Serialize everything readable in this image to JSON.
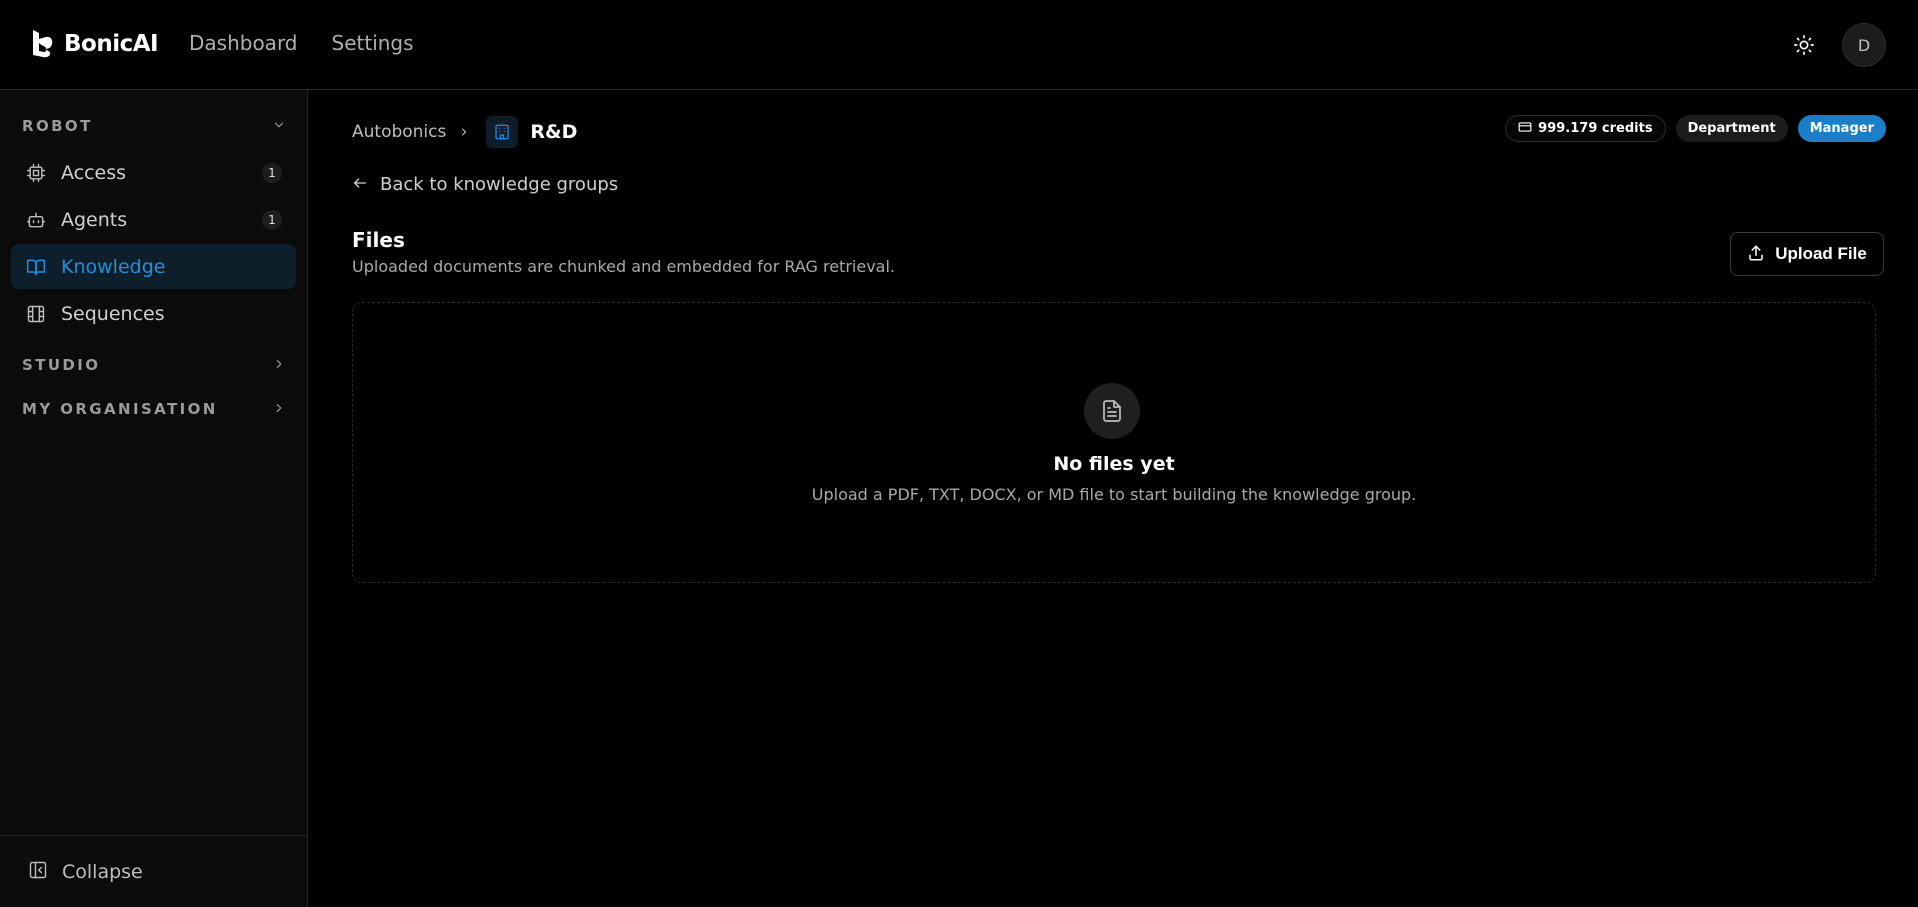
{
  "header": {
    "brand": "BonicAI",
    "nav": [
      "Dashboard",
      "Settings"
    ],
    "avatar_initial": "D"
  },
  "sidebar": {
    "robot": {
      "title": "ROBOT",
      "items": [
        {
          "label": "Access",
          "badge": "1",
          "icon": "cpu-icon"
        },
        {
          "label": "Agents",
          "badge": "1",
          "icon": "bot-icon"
        },
        {
          "label": "Knowledge",
          "badge": "",
          "icon": "book-open-icon",
          "active": true
        },
        {
          "label": "Sequences",
          "badge": "",
          "icon": "film-icon"
        }
      ]
    },
    "studio_title": "STUDIO",
    "org_title": "MY ORGANISATION",
    "collapse_label": "Collapse"
  },
  "main": {
    "breadcrumb": {
      "root": "Autobonics",
      "current": "R&D"
    },
    "pills": {
      "credits": "999.179 credits",
      "department": "Department",
      "role": "Manager"
    },
    "back_label": "Back to knowledge groups",
    "files": {
      "title": "Files",
      "subtitle": "Uploaded documents are chunked and embedded for RAG retrieval.",
      "upload_label": "Upload File"
    },
    "empty": {
      "title": "No files yet",
      "subtitle": "Upload a PDF, TXT, DOCX, or MD file to start building the knowledge group."
    }
  },
  "colors": {
    "accent": "#1e90e0",
    "role_pill": "#1a7fc8",
    "background": "#000000",
    "sidebar_bg": "#0b0b0b"
  }
}
